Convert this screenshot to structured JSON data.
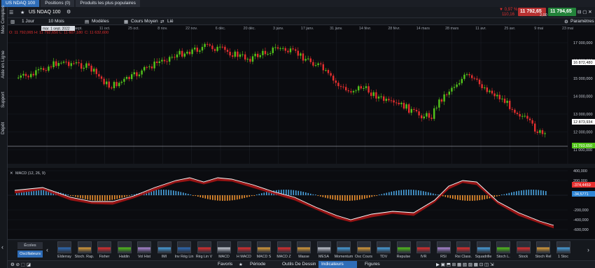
{
  "tabs": [
    {
      "label": "US NDAQ 100"
    },
    {
      "label": "Positions (0)"
    },
    {
      "label": "Produits les plus populaires"
    }
  ],
  "side_labels": [
    "Mes Comptes",
    "Aide en Ligne",
    "Support",
    "Dépôt"
  ],
  "instrument": {
    "label": "US NDAQ 100",
    "change_pct": "▼ 0,97 %",
    "change_pts": "110,16",
    "sell_price": "11 792,65",
    "buy_price": "11 794,65",
    "spread": "2,00"
  },
  "toolbar": {
    "period": "1 Jour",
    "range": "10 Mois",
    "models": "Modèles",
    "average": "Cours Moyen",
    "linked": "Lié",
    "settings": "Paramètres"
  },
  "ohlc": {
    "o": "O: 11 792,065",
    "h": "H: 11 792,650",
    "l": "L: 11 607,180",
    "c": "C: 11 632,600"
  },
  "hover_tag": "mar. 1 sept. 2022",
  "x_axis": [
    "7 sept.",
    "27 sept.",
    "11 oct.",
    "25 oct.",
    "8 nov.",
    "22 nov.",
    "6 déc.",
    "20 déc.",
    "3 janv.",
    "17 janv.",
    "31 janv.",
    "14 févr.",
    "28 févr.",
    "14 mars",
    "28 mars",
    "11 avr.",
    "25 avr.",
    "9 mai",
    "23 mai"
  ],
  "y_axis": [
    "17 000,000",
    "16 000,000",
    "15 000,000",
    "14 000,000",
    "13 000,000",
    "12 000,000",
    "11 000,000"
  ],
  "price_tags": {
    "high": "16 872,480",
    "mid": "12 873,934",
    "last": "11 793,650"
  },
  "macd": {
    "label": "MACD (12, 26, 9)",
    "y_axis": [
      "400,000",
      "200,000",
      "-200,000",
      "-400,000",
      "-600,000"
    ],
    "tag_macd": "-374,4459",
    "tag_signal": "-34,5771"
  },
  "indicator_tabs": {
    "trends": "Écoles",
    "oscillators": "Oscillateurs"
  },
  "indicators": [
    "Elderray",
    "Stoch. Rap.",
    "Fisher",
    "Haldin",
    "Vol Hist",
    "IMI",
    "Inv Rég Lin",
    "Rég Lin V",
    "MACD",
    "H MACD",
    "MACD S",
    "MACD Z",
    "Masse",
    "MESA",
    "Momentum",
    "Osc Cours",
    "TDV",
    "Repulse",
    "IVR",
    "RSI",
    "Rsi Class.",
    "Squadrille",
    "Stoch L.",
    "Stock",
    "Stoch Rel",
    "1 Stoc"
  ],
  "bottom": {
    "favorites": "Favoris",
    "period": "Période",
    "drawing": "Outils De Dessin",
    "indicators": "Indicateurs",
    "figures": "Figures"
  },
  "colors": {
    "up": "#53c41b",
    "down": "#e52f2f",
    "macd_fill": "#b01717",
    "macd_line": "#ffffff",
    "hist_pos": "#4aa3e0",
    "hist_neg": "#f0922e",
    "accent": "#2f6db8"
  }
}
